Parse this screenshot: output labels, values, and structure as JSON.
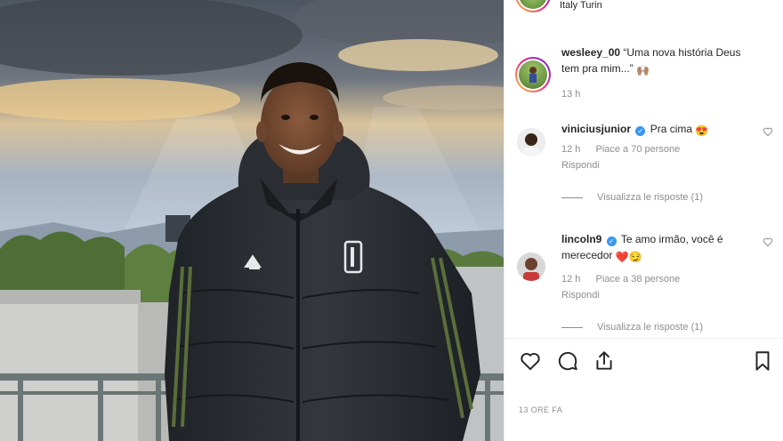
{
  "location": {
    "text": "Italy Turin"
  },
  "caption": {
    "username": "wesleey_00",
    "text_line1": "“Uma nova história Deus",
    "text_line2": "tem pra mim...”",
    "emoji": "🙌🏽",
    "time": "13 h"
  },
  "comments": [
    {
      "username": "viniciusjunior",
      "verified": true,
      "text": "Pra cima",
      "emoji": "😍",
      "time": "12 h",
      "likes": "Piace a 70 persone",
      "reply": "Rispondi",
      "view_replies": "Visualizza le risposte (1)"
    },
    {
      "username": "lincoln9",
      "verified": true,
      "text_line1": "Te amo irmão, você é",
      "text_line2": "merecedor",
      "emoji": "❤️😏",
      "time": "12 h",
      "likes": "Piace a 38 persone",
      "reply": "Rispondi",
      "view_replies": "Visualizza le risposte (1)"
    }
  ],
  "post_time": "13 ORE FA",
  "colors": {
    "accent_verified": "#3897f0",
    "meta_gray": "#8e8e8e",
    "heart_red": "#ed4956"
  },
  "icons": [
    "heart-icon",
    "comment-icon",
    "share-icon",
    "bookmark-icon"
  ]
}
